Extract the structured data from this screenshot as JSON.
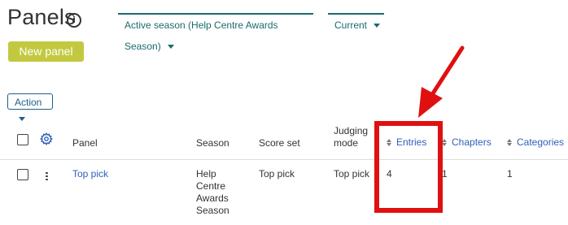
{
  "header": {
    "title": "Panels",
    "info_glyph": "i",
    "season_dropdown": "Active season (Help Centre Awards Season)",
    "status_dropdown": "Current"
  },
  "toolbar": {
    "new_panel_label": "New panel",
    "action_label": "Action"
  },
  "table": {
    "columns": {
      "panel": "Panel",
      "season": "Season",
      "score_set": "Score set",
      "judging_mode": "Judging mode",
      "entries": "Entries",
      "chapters": "Chapters",
      "categories": "Categories"
    },
    "rows": [
      {
        "panel": "Top pick",
        "season": "Help Centre Awards Season",
        "score_set": "Top pick",
        "judging_mode": "Top pick",
        "entries": "4",
        "chapters": "1",
        "categories": "1"
      }
    ]
  },
  "colors": {
    "accent": "#1a6b6b",
    "primary_button": "#c2c940",
    "link": "#2f5fb8",
    "annotation": "#e01010"
  },
  "icons": [
    "info-icon",
    "caret-down-icon",
    "gear-icon",
    "sort-icon",
    "kebab-icon",
    "annotation-arrow"
  ]
}
